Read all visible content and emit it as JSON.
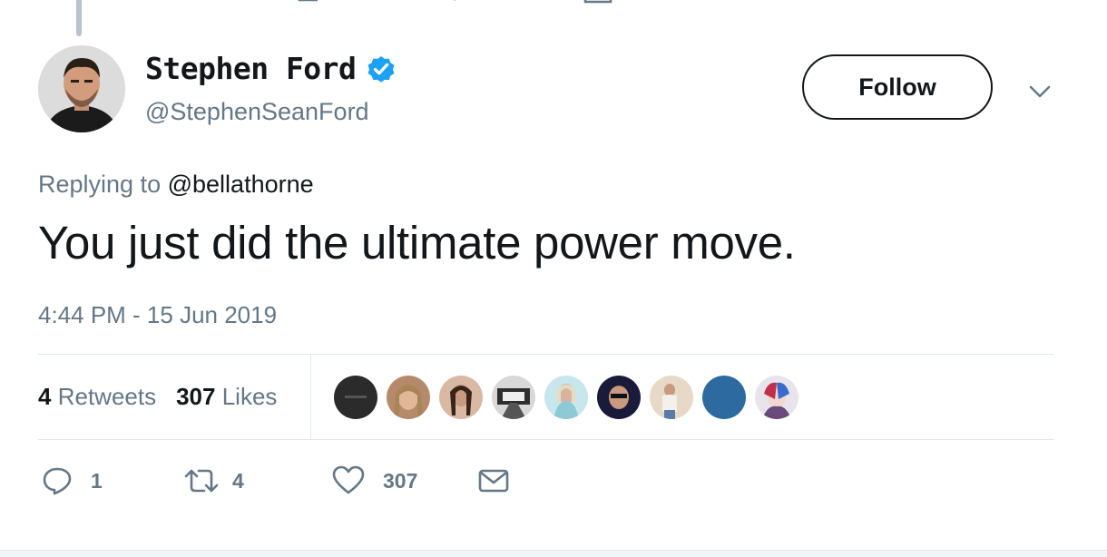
{
  "tweet": {
    "author": {
      "display_name": "Stephen Ford",
      "handle": "@StephenSeanFord",
      "verified": true,
      "avatar_icon": "avatar-photo"
    },
    "follow_label": "Follow",
    "replying_prefix": "Replying to",
    "replying_to": "@bellathorne",
    "text": "You just did the ultimate power move.",
    "timestamp": "4:44 PM - 15 Jun 2019"
  },
  "stats": {
    "retweets_count": "4",
    "retweets_label": "Retweets",
    "likes_count": "307",
    "likes_label": "Likes"
  },
  "likers": [
    {
      "icon": "liker-avatar-1",
      "color": "#2b2b2b"
    },
    {
      "icon": "liker-avatar-2",
      "color": "#b58a6a"
    },
    {
      "icon": "liker-avatar-3",
      "color": "#d9b8a4"
    },
    {
      "icon": "liker-avatar-4",
      "color": "#7d7d7d"
    },
    {
      "icon": "liker-avatar-5",
      "color": "#8ec9d6"
    },
    {
      "icon": "liker-avatar-6",
      "color": "#1a1a3a"
    },
    {
      "icon": "liker-avatar-7",
      "color": "#e8d8c8"
    },
    {
      "icon": "liker-avatar-8",
      "color": "#2c6aa0"
    },
    {
      "icon": "liker-avatar-9",
      "color": "#9a8aa8"
    }
  ],
  "actions": {
    "reply_count": "1",
    "retweet_count": "4",
    "like_count": "307"
  },
  "colors": {
    "verified": "#1da1f2",
    "secondary_text": "#657786",
    "primary_text": "#14171a",
    "divider": "#e1e8ed"
  }
}
